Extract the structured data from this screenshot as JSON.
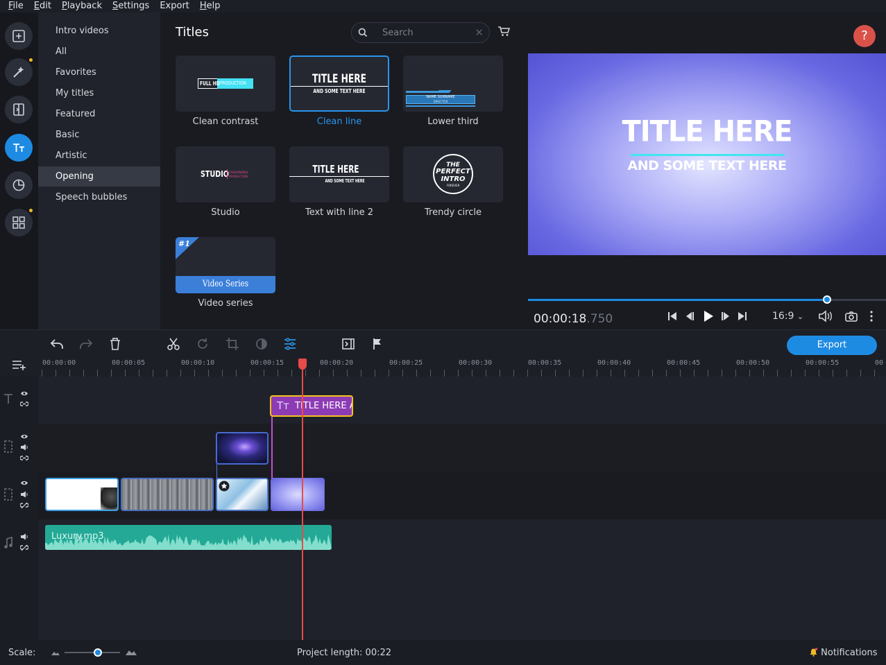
{
  "menu": [
    {
      "key": "F",
      "rest": "ile"
    },
    {
      "key": "E",
      "rest": "dit"
    },
    {
      "key": "P",
      "rest": "layback"
    },
    {
      "key": "S",
      "rest": "ettings"
    },
    {
      "key": "",
      "rest": "Export"
    },
    {
      "key": "H",
      "rest": "elp"
    }
  ],
  "tools": [
    "import-icon",
    "magic-wand-icon",
    "transitions-icon",
    "titles-icon",
    "stickers-icon",
    "more-tools-icon"
  ],
  "categories": [
    "Intro videos",
    "All",
    "Favorites",
    "My titles",
    "Featured",
    "Basic",
    "Artistic",
    "Opening",
    "Speech bubbles"
  ],
  "selected_category": "Opening",
  "panel": {
    "title": "Titles",
    "search_placeholder": "Search"
  },
  "thumbnails": [
    {
      "label": "Clean contrast",
      "selected": false
    },
    {
      "label": "Clean line",
      "selected": true
    },
    {
      "label": "Lower third",
      "selected": false
    },
    {
      "label": "Studio",
      "selected": false
    },
    {
      "label": "Text with line 2",
      "selected": false
    },
    {
      "label": "Trendy circle",
      "selected": false
    },
    {
      "label": "Video series",
      "selected": false
    }
  ],
  "thumb_text": {
    "clean_contrast_a": "FULL HD",
    "clean_contrast_b": "PRODUCTION",
    "clean_line_title": "TITLE HERE",
    "clean_line_sub": "AND SOME TEXT HERE",
    "lower_third_name": "NAME SURNAME",
    "lower_third_sub": "DIRECTOR",
    "studio_main": "STUDIO",
    "studio_a": "FASHIONABLE",
    "studio_b": "PRODUCTION",
    "twl_title": "TITLE HERE",
    "twl_sub": "AND SOME TEXT HERE",
    "trendy_1": "THE",
    "trendy_2": "PERFECT",
    "trendy_3": "INTRO",
    "trendy_4": "FOREVER",
    "series_num": "#1",
    "series_label": "Video Series"
  },
  "preview": {
    "help": "?",
    "title": "TITLE HERE",
    "subtitle": "AND SOME TEXT HERE",
    "timecode_main": "00:00:18",
    "timecode_ms": ".750",
    "aspect": "16:9",
    "progress": 0.836
  },
  "toolbar": {
    "export": "Export"
  },
  "ruler": [
    "00:00:00",
    "00:00:05",
    "00:00:10",
    "00:00:15",
    "00:00:20",
    "00:00:25",
    "00:00:30",
    "00:00:35",
    "00:00:40",
    "00:00:45",
    "00:00:50",
    "00:00:55",
    "00"
  ],
  "title_clip": "TITLE HERE A",
  "audio_clip": "Luxury.mp3",
  "status": {
    "scale_label": "Scale:",
    "scale_value": 0.6,
    "project_length": "Project length:  00:22",
    "notifications": "Notifications"
  },
  "colors": {
    "accent": "#1e8be3",
    "title_clip": "#8d3bb5",
    "audio_clip": "#23a996",
    "playhead": "#e74a4a",
    "help": "#d9524a"
  }
}
